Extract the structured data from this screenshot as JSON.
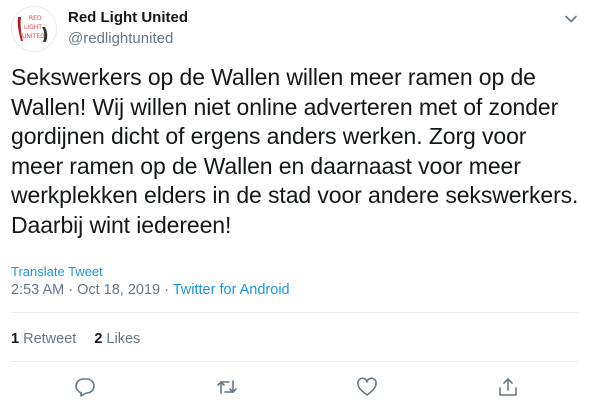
{
  "author": {
    "display_name": "Red Light United",
    "handle": "@redlightunited",
    "avatar_text": [
      "RED",
      "LIGHT",
      "UNITED"
    ]
  },
  "tweet": {
    "text": "Sekswerkers op de Wallen willen meer ramen op de Wallen! Wij willen niet online adverteren met of zonder gordijnen dicht of ergens anders werken. Zorg voor meer ramen op de Wallen en daarnaast voor meer werkplekken elders in de stad voor andere sekswerkers. Daarbij wint iedereen!",
    "translate_label": "Translate Tweet",
    "time": "2:53 AM",
    "separator": " · ",
    "date": "Oct 18, 2019",
    "source": "Twitter for Android"
  },
  "stats": {
    "retweets_count": "1",
    "retweets_label": "Retweet",
    "likes_count": "2",
    "likes_label": "Likes"
  },
  "colors": {
    "link": "#1b95e0",
    "secondary": "#657786",
    "text": "#14171a",
    "divider": "#e6ecf0"
  },
  "icons": [
    "chevron-down-icon",
    "reply-icon",
    "retweet-icon",
    "like-icon",
    "share-icon"
  ]
}
